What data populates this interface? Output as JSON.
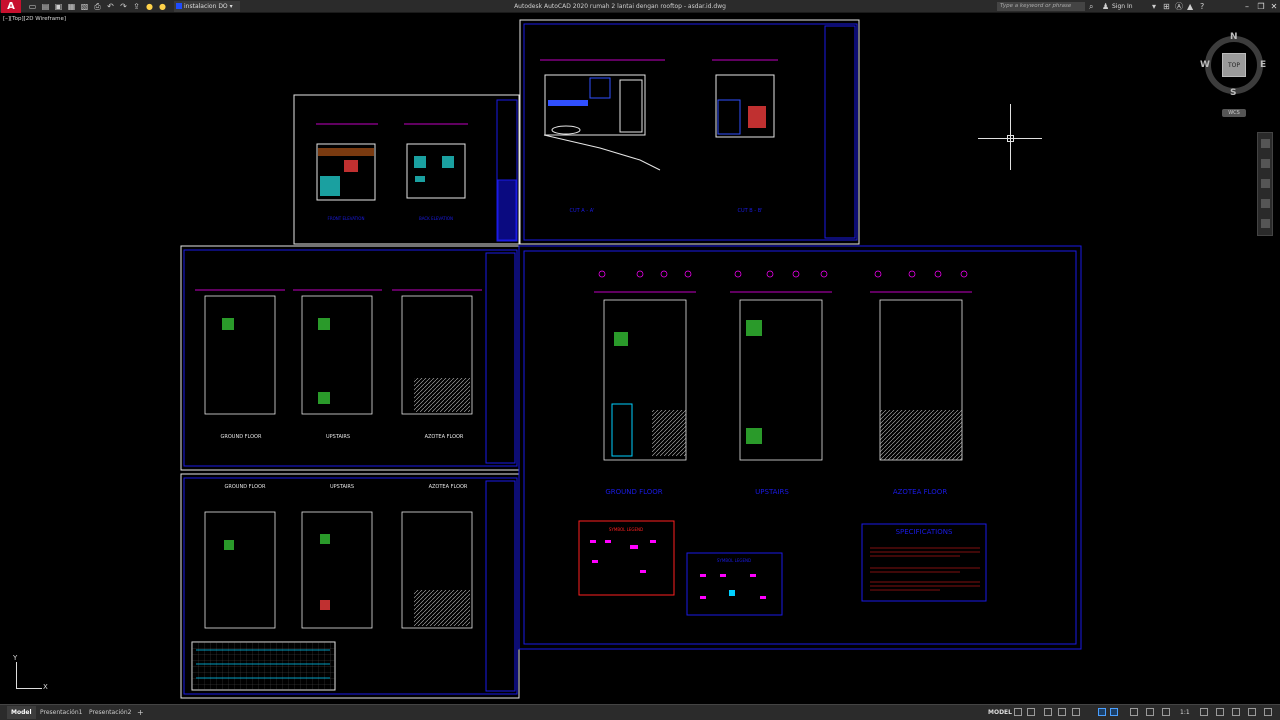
{
  "titlebar": {
    "logo": "A",
    "workspace": "instalacion DO",
    "title": "Autodesk AutoCAD 2020   rumah 2 lantai dengan rooftop - asdar.id.dwg",
    "search_placeholder": "Type a keyword or phrase",
    "sign_in": "Sign In",
    "help": "?",
    "minimize": "–",
    "restore": "❐",
    "close": "✕"
  },
  "viewport": {
    "label": "[–][Top][2D Wireframe]"
  },
  "viewcube": {
    "north": "N",
    "south": "S",
    "east": "E",
    "west": "W",
    "face": "TOP",
    "wcs": "WCS"
  },
  "ucs": {
    "x": "X",
    "y": "Y"
  },
  "sheets": {
    "elevations": {
      "label_left": "FRONT ELEVATION",
      "label_right": "BACK ELEVATION"
    },
    "sections": {
      "label_a": "CUT A - A'",
      "label_b": "CUT B - B'"
    },
    "plans_top": {
      "ground": "GROUND\nFLOOR",
      "upstairs": "UPSTAIRS",
      "azotea": "AZOTEA FLOOR"
    },
    "plans_bottom": {
      "ground": "GROUND\nFLOOR",
      "upstairs": "UPSTAIRS",
      "azotea": "AZOTEA FLOOR"
    },
    "main": {
      "ground": "GROUND\nFLOOR",
      "upstairs": "UPSTAIRS",
      "azotea": "AZOTEA FLOOR",
      "legend1_title": "SYMBOL LEGEND",
      "legend2_title": "SYMBOL LEGEND",
      "spec_title": "SPECIFICATIONS"
    }
  },
  "tabs": [
    {
      "label": "Model",
      "active": true
    },
    {
      "label": "Presentación1",
      "active": false
    },
    {
      "label": "Presentación2",
      "active": false
    }
  ],
  "tab_add": "+",
  "status": {
    "model": "MODEL",
    "scale": "1:1"
  },
  "colors": {
    "frame": "#1a1ae6",
    "white": "#ffffff",
    "magenta": "#ff00ff",
    "cyan": "#00ffff",
    "red": "#ff2020",
    "green": "#00c000",
    "yellow": "#ffff00"
  }
}
